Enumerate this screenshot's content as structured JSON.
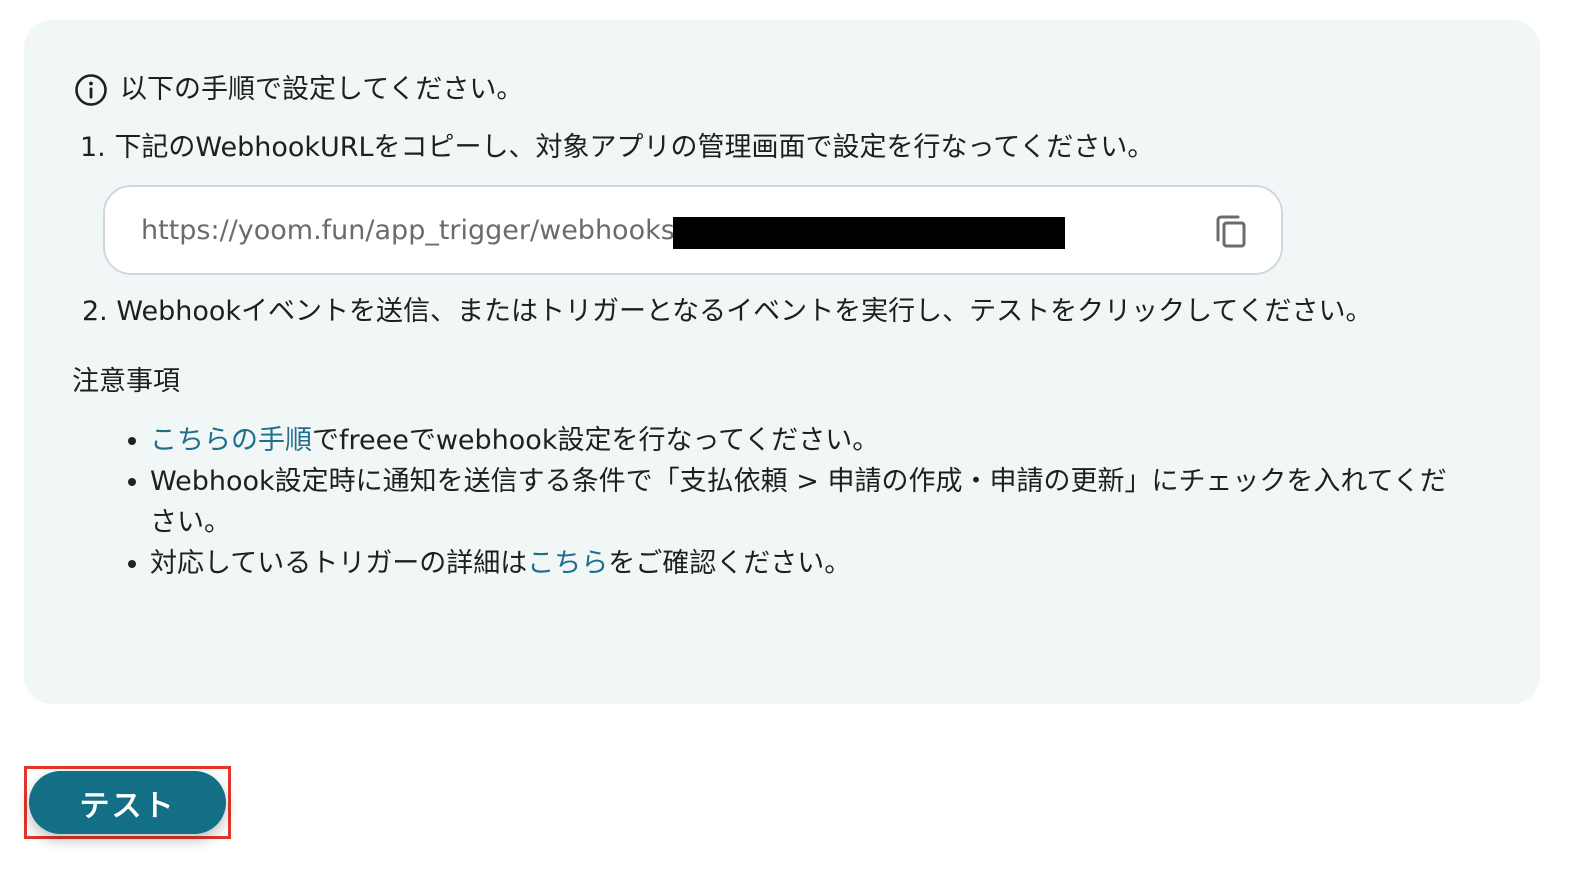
{
  "panel": {
    "info_text": "以下の手順で設定してください。",
    "step1": "1. 下記のWebhookURLをコピーし、対象アプリの管理画面で設定を行なってください。",
    "url_value": "https://yoom.fun/app_trigger/webhooks/",
    "step2": "2. Webhookイベントを送信、またはトリガーとなるイベントを実行し、テストをクリックしてください。",
    "notes_heading": "注意事項",
    "notes": {
      "item1_link": "こちらの手順",
      "item1_text": "でfreeeでwebhook設定を行なってください。",
      "item2_text": "Webhook設定時に通知を送信する条件で「支払依頼 > 申請の作成・申請の更新」にチェックを入れてください。",
      "item3_text_before": "対応しているトリガーの詳細は",
      "item3_link": "こちら",
      "item3_text_after": "をご確認ください。"
    }
  },
  "icons": {
    "info": "info-icon",
    "copy": "copy-icon"
  },
  "colors": {
    "panel_bg": "#f1f7f7",
    "link": "#1f6f8b",
    "primary_button": "#136f86",
    "highlight_border": "#e5352a"
  },
  "test_button_label": "テスト"
}
